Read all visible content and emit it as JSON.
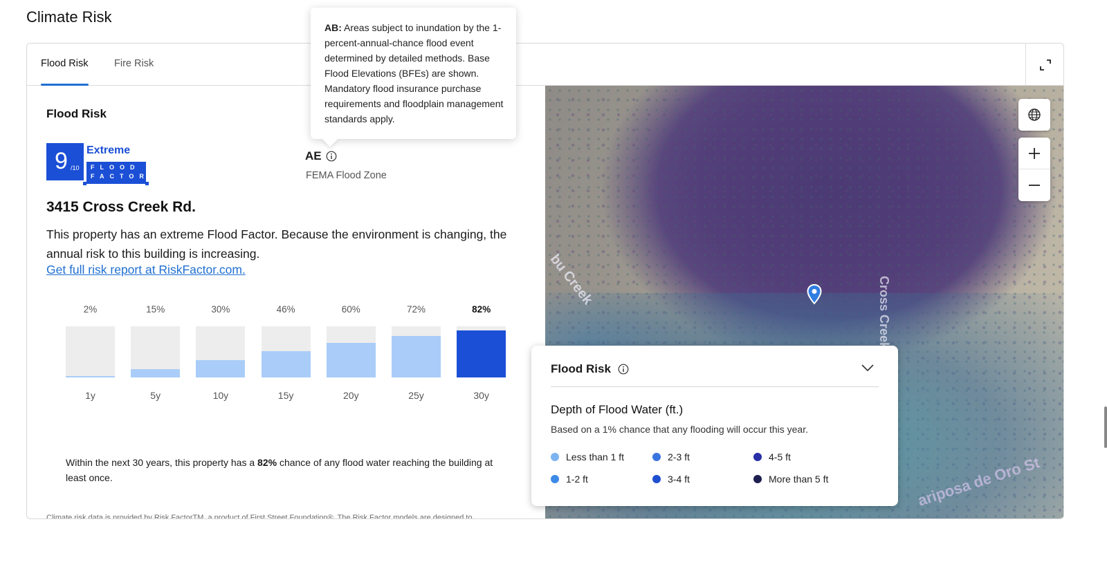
{
  "page": {
    "title": "Climate Risk"
  },
  "tabs": [
    {
      "label": "Flood Risk",
      "active": true
    },
    {
      "label": "Fire Risk",
      "active": false
    }
  ],
  "flood": {
    "section_title": "Flood Risk",
    "factor": {
      "score": "9",
      "out_of": "/10",
      "level": "Extreme",
      "brand_line1": "FLOOD",
      "brand_line2": "FACTOR"
    },
    "zone": {
      "code": "AE",
      "label": "FEMA Flood Zone"
    },
    "address": "3415 Cross Creek Rd.",
    "description": "This property has an extreme Flood Factor. Because the environment is changing, the annual risk to this building is increasing.",
    "report_link": "Get full risk report at RiskFactor.com.",
    "chance_text": {
      "before": "Within the next 30 years, this property has a ",
      "highlight": "82%",
      "after": " chance of any  flood water reaching the building at least once."
    },
    "footnote": "Climate risk data is provided by Risk FactorTM, a product of First Street Foundation®. The Risk Factor models are designed to approximate risk and not intended to include all possible scenarios."
  },
  "chart_data": {
    "type": "bar",
    "categories": [
      "1y",
      "5y",
      "10y",
      "15y",
      "20y",
      "25y",
      "30y"
    ],
    "values": [
      2,
      15,
      30,
      46,
      60,
      72,
      82
    ],
    "labels": [
      "2%",
      "15%",
      "30%",
      "46%",
      "60%",
      "72%",
      "82%"
    ],
    "ylim": [
      0,
      100
    ],
    "highlight_index": 6,
    "colors": {
      "track": "#ededed",
      "fill": "#a9cdf8",
      "highlight": "#1b4fd6"
    }
  },
  "tooltip": {
    "code": "AB:",
    "text": " Areas subject to inundation by the 1-percent-annual-chance flood event determined by detailed methods. Base Flood Elevations (BFEs) are shown. Mandatory flood insurance purchase requirements and floodplain management standards apply."
  },
  "map": {
    "labels": {
      "creek": "bu Creek",
      "road": "Cross Creek R",
      "street": "ariposa de Oro St"
    },
    "controls": [
      "globe-icon",
      "zoom-in-icon",
      "zoom-out-icon"
    ],
    "legend": {
      "title": "Flood Risk",
      "subtitle": "Depth of Flood Water (ft.)",
      "note": "Based on a 1% chance that any flooding will occur this year.",
      "items": [
        {
          "label": "Less than 1 ft",
          "color": "#7cb3f0"
        },
        {
          "label": "1-2 ft",
          "color": "#3d8ae8"
        },
        {
          "label": "2-3 ft",
          "color": "#3a75e0"
        },
        {
          "label": "3-4 ft",
          "color": "#1f4fd0"
        },
        {
          "label": "4-5 ft",
          "color": "#2a2fa8"
        },
        {
          "label": "More than 5 ft",
          "color": "#1e1f4f"
        }
      ]
    }
  },
  "colors": {
    "accent": "#1f6fd1",
    "brand": "#1b4fd6"
  }
}
